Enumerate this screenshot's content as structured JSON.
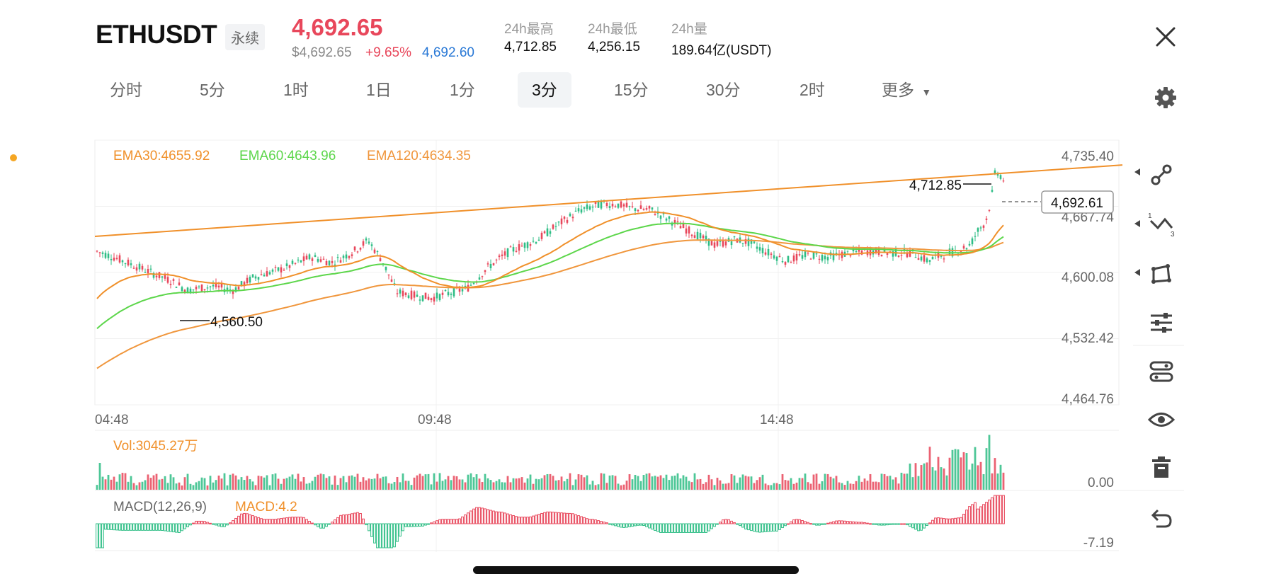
{
  "header": {
    "symbol": "ETHUSDT",
    "contract_type": "永续",
    "last_price": "4,692.65",
    "usd_price": "$4,692.65",
    "change_pct": "+9.65%",
    "mark_price": "4,692.60",
    "stats": [
      {
        "label": "24h最高",
        "value": "4,712.85"
      },
      {
        "label": "24h最低",
        "value": "4,256.15"
      },
      {
        "label": "24h量",
        "value": "189.64亿(USDT)"
      }
    ]
  },
  "timeframes": [
    {
      "label": "分时",
      "active": false
    },
    {
      "label": "5分",
      "active": false
    },
    {
      "label": "1时",
      "active": false
    },
    {
      "label": "1日",
      "active": false
    },
    {
      "label": "1分",
      "active": false
    },
    {
      "label": "3分",
      "active": true
    },
    {
      "label": "15分",
      "active": false
    },
    {
      "label": "30分",
      "active": false
    },
    {
      "label": "2时",
      "active": false
    },
    {
      "label": "更多",
      "active": false
    }
  ],
  "chart_data": {
    "type": "line",
    "title": "",
    "series": [
      {
        "name": "EMA30",
        "legend": "EMA30:4655.92",
        "color": "#f0902a"
      },
      {
        "name": "EMA60",
        "legend": "EMA60:4643.96",
        "color": "#5cd64a"
      },
      {
        "name": "EMA120",
        "legend": "EMA120:4634.35",
        "color": "#f0963c"
      }
    ],
    "y_ticks": [
      "4,735.40",
      "4,667.74",
      "4,600.08",
      "4,532.42",
      "4,464.76"
    ],
    "ylim": [
      4464.76,
      4735.4
    ],
    "x_ticks": [
      "04:48",
      "09:48",
      "14:48"
    ],
    "high_label": "4,712.85",
    "low_label": "4,560.50",
    "current_price_label": "4,692.61",
    "volume": {
      "legend": "Vol:3045.27万",
      "axis_label": "0.00"
    },
    "macd": {
      "params": "MACD(12,26,9)",
      "legend": "MACD:4.2",
      "axis_label": "-7.19"
    },
    "candle_colors": {
      "up": "#e8475b",
      "down": "#2ebd85"
    }
  },
  "toolbar": [
    {
      "icon": "trendline-icon"
    },
    {
      "icon": "multi-line-icon"
    },
    {
      "icon": "shape-icon"
    },
    {
      "icon": "indicator-settings-icon"
    },
    {
      "icon": "template-icon"
    },
    {
      "icon": "visibility-eye-icon"
    },
    {
      "icon": "trash-icon"
    },
    {
      "icon": "undo-icon"
    }
  ]
}
